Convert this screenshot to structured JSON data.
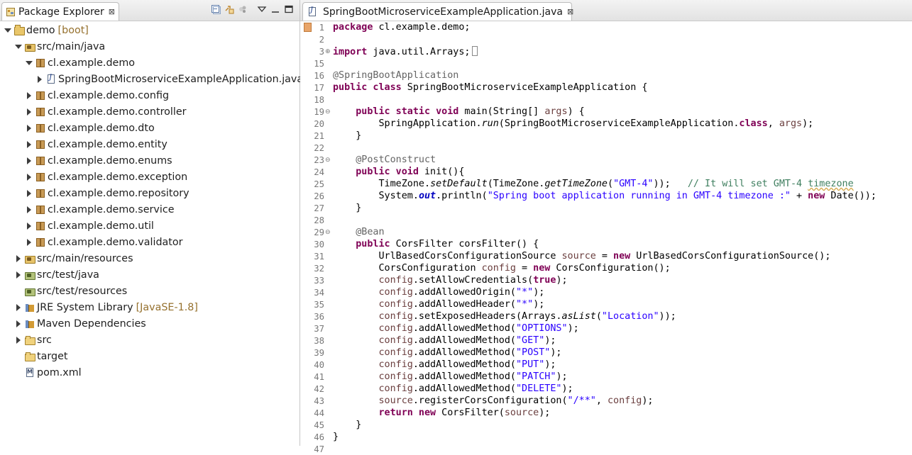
{
  "explorer": {
    "tab_label": "Package Explorer",
    "close_glyph": "⊠",
    "tree": [
      {
        "label": "demo",
        "decor": "[boot]",
        "icon": "project-icon",
        "twisty": "open",
        "level": 0
      },
      {
        "label": "src/main/java",
        "decor": "",
        "icon": "source-folder-icon",
        "twisty": "open",
        "level": 1
      },
      {
        "label": "cl.example.demo",
        "decor": "",
        "icon": "package-icon",
        "twisty": "open",
        "level": 2
      },
      {
        "label": "SpringBootMicroserviceExampleApplication.java",
        "decor": "",
        "icon": "java-file-icon",
        "twisty": "closed",
        "level": 3
      },
      {
        "label": "cl.example.demo.config",
        "decor": "",
        "icon": "package-icon",
        "twisty": "closed",
        "level": 2
      },
      {
        "label": "cl.example.demo.controller",
        "decor": "",
        "icon": "package-icon",
        "twisty": "closed",
        "level": 2
      },
      {
        "label": "cl.example.demo.dto",
        "decor": "",
        "icon": "package-icon",
        "twisty": "closed",
        "level": 2
      },
      {
        "label": "cl.example.demo.entity",
        "decor": "",
        "icon": "package-icon",
        "twisty": "closed",
        "level": 2
      },
      {
        "label": "cl.example.demo.enums",
        "decor": "",
        "icon": "package-icon",
        "twisty": "closed",
        "level": 2
      },
      {
        "label": "cl.example.demo.exception",
        "decor": "",
        "icon": "package-icon",
        "twisty": "closed",
        "level": 2
      },
      {
        "label": "cl.example.demo.repository",
        "decor": "",
        "icon": "package-icon",
        "twisty": "closed",
        "level": 2
      },
      {
        "label": "cl.example.demo.service",
        "decor": "",
        "icon": "package-icon",
        "twisty": "closed",
        "level": 2
      },
      {
        "label": "cl.example.demo.util",
        "decor": "",
        "icon": "package-icon",
        "twisty": "closed",
        "level": 2
      },
      {
        "label": "cl.example.demo.validator",
        "decor": "",
        "icon": "package-icon",
        "twisty": "closed",
        "level": 2
      },
      {
        "label": "src/main/resources",
        "decor": "",
        "icon": "source-folder-icon",
        "twisty": "closed",
        "level": 1
      },
      {
        "label": "src/test/java",
        "decor": "",
        "icon": "test-folder-icon",
        "twisty": "closed",
        "level": 1
      },
      {
        "label": "src/test/resources",
        "decor": "",
        "icon": "test-folder-icon",
        "twisty": "none",
        "level": 1
      },
      {
        "label": "JRE System Library",
        "decor": "[JavaSE-1.8]",
        "icon": "library-icon",
        "twisty": "closed",
        "level": 1
      },
      {
        "label": "Maven Dependencies",
        "decor": "",
        "icon": "library-icon",
        "twisty": "closed",
        "level": 1
      },
      {
        "label": "src",
        "decor": "",
        "icon": "folder-icon",
        "twisty": "closed",
        "level": 1
      },
      {
        "label": "target",
        "decor": "",
        "icon": "folder-icon",
        "twisty": "none",
        "level": 1
      },
      {
        "label": "pom.xml",
        "decor": "",
        "icon": "xml-file-icon",
        "twisty": "none",
        "level": 1
      }
    ]
  },
  "editor": {
    "tab_label": "SpringBootMicroserviceExampleApplication.java",
    "close_glyph": "⊠",
    "lines": [
      {
        "no": "1",
        "fold": "",
        "html": "<span class='kw'>package</span> cl.example.demo;"
      },
      {
        "no": "2",
        "fold": "",
        "html": ""
      },
      {
        "no": "3",
        "fold": "⊕",
        "html": "<span class='kw'>import</span> java.util.Arrays;<span class='boxmark'></span>"
      },
      {
        "no": "15",
        "fold": "",
        "html": ""
      },
      {
        "no": "16",
        "fold": "",
        "html": "<span class='ann'>@SpringBootApplication</span>"
      },
      {
        "no": "17",
        "fold": "",
        "html": "<span class='kw'>public class</span> SpringBootMicroserviceExampleApplication {"
      },
      {
        "no": "18",
        "fold": "",
        "html": ""
      },
      {
        "no": "19",
        "fold": "⊖",
        "html": "    <span class='kw'>public static void</span> main(String[] <span class='var'>args</span>) {"
      },
      {
        "no": "20",
        "fold": "",
        "html": "        SpringApplication.<span class='itl'>run</span>(SpringBootMicroserviceExampleApplication.<span class='kw'>class</span>, <span class='var'>args</span>);"
      },
      {
        "no": "21",
        "fold": "",
        "html": "    }"
      },
      {
        "no": "22",
        "fold": "",
        "html": ""
      },
      {
        "no": "23",
        "fold": "⊖",
        "html": "    <span class='ann'>@PostConstruct</span>"
      },
      {
        "no": "24",
        "fold": "",
        "html": "    <span class='kw'>public void</span> init(){"
      },
      {
        "no": "25",
        "fold": "",
        "html": "        TimeZone.<span class='itl'>setDefault</span>(TimeZone.<span class='itl'>getTimeZone</span>(<span class='str'>\"GMT-4\"</span>));   <span class='cmt'>// It will set GMT-4 <span class='squig'>timezone</span></span>"
      },
      {
        "no": "26",
        "fold": "",
        "html": "        System.<span class='fld'>out</span>.println(<span class='str'>\"Spring boot application running in GMT-4 timezone :\"</span> + <span class='kw'>new</span> Date());"
      },
      {
        "no": "27",
        "fold": "",
        "html": "    }"
      },
      {
        "no": "28",
        "fold": "",
        "html": ""
      },
      {
        "no": "29",
        "fold": "⊖",
        "html": "    <span class='ann'>@Bean</span>"
      },
      {
        "no": "30",
        "fold": "",
        "html": "    <span class='kw'>public</span> CorsFilter corsFilter() {"
      },
      {
        "no": "31",
        "fold": "",
        "html": "        UrlBasedCorsConfigurationSource <span class='var'>source</span> = <span class='kw'>new</span> UrlBasedCorsConfigurationSource();"
      },
      {
        "no": "32",
        "fold": "",
        "html": "        CorsConfiguration <span class='var'>config</span> = <span class='kw'>new</span> CorsConfiguration();"
      },
      {
        "no": "33",
        "fold": "",
        "html": "        <span class='var'>config</span>.setAllowCredentials(<span class='kw'>true</span>);"
      },
      {
        "no": "34",
        "fold": "",
        "html": "        <span class='var'>config</span>.addAllowedOrigin(<span class='str'>\"*\"</span>);"
      },
      {
        "no": "35",
        "fold": "",
        "html": "        <span class='var'>config</span>.addAllowedHeader(<span class='str'>\"*\"</span>);"
      },
      {
        "no": "36",
        "fold": "",
        "html": "        <span class='var'>config</span>.setExposedHeaders(Arrays.<span class='itl'>asList</span>(<span class='str'>\"Location\"</span>));"
      },
      {
        "no": "37",
        "fold": "",
        "html": "        <span class='var'>config</span>.addAllowedMethod(<span class='str'>\"OPTIONS\"</span>);"
      },
      {
        "no": "38",
        "fold": "",
        "html": "        <span class='var'>config</span>.addAllowedMethod(<span class='str'>\"GET\"</span>);"
      },
      {
        "no": "39",
        "fold": "",
        "html": "        <span class='var'>config</span>.addAllowedMethod(<span class='str'>\"POST\"</span>);"
      },
      {
        "no": "40",
        "fold": "",
        "html": "        <span class='var'>config</span>.addAllowedMethod(<span class='str'>\"PUT\"</span>);"
      },
      {
        "no": "41",
        "fold": "",
        "html": "        <span class='var'>config</span>.addAllowedMethod(<span class='str'>\"PATCH\"</span>);"
      },
      {
        "no": "42",
        "fold": "",
        "html": "        <span class='var'>config</span>.addAllowedMethod(<span class='str'>\"DELETE\"</span>);"
      },
      {
        "no": "43",
        "fold": "",
        "html": "        <span class='var'>source</span>.registerCorsConfiguration(<span class='str'>\"/**\"</span>, <span class='var'>config</span>);"
      },
      {
        "no": "44",
        "fold": "",
        "html": "        <span class='kw'>return new</span> CorsFilter(<span class='var'>source</span>);"
      },
      {
        "no": "45",
        "fold": "",
        "html": "    }"
      },
      {
        "no": "46",
        "fold": "",
        "html": "}"
      },
      {
        "no": "47",
        "fold": "",
        "html": ""
      }
    ]
  }
}
